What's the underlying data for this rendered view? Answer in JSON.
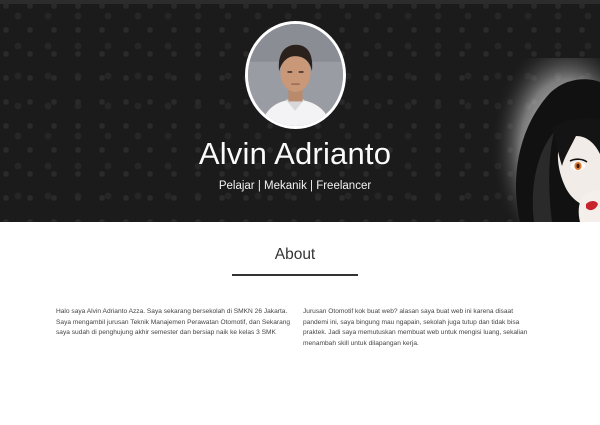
{
  "header": {
    "name": "Alvin Adrianto",
    "subtitle": "Pelajar | Mekanik | Freelancer"
  },
  "about": {
    "title": "About",
    "paragraph_left": "Halo saya Alvin Adrianto Azza. Saya sekarang bersekolah di SMKN 26 Jakarta. Saya mengambil jurusan Teknik Manajemen Perawatan Otomotif, dan Sekarang saya sudah di penghujung akhir semester dan bersiap naik ke kelas 3 SMK",
    "paragraph_right": "Jurusan Otomotif kok buat web? alasan saya buat web ini karena disaat pandemi ini, saya bingung mau ngapain, sekolah juga tutup dan tidak bisa praktek. Jadi saya memutuskan membuat web untuk mengisi luang, sekalian menambah skill untuk dilapangan kerja."
  },
  "colors": {
    "header_background": "#1b1b1b",
    "header_text": "#ffffff",
    "body_text": "#444444",
    "title_text": "#333333"
  },
  "icons": {
    "profile": "profile-photo",
    "decoration": "anime-character-art"
  }
}
